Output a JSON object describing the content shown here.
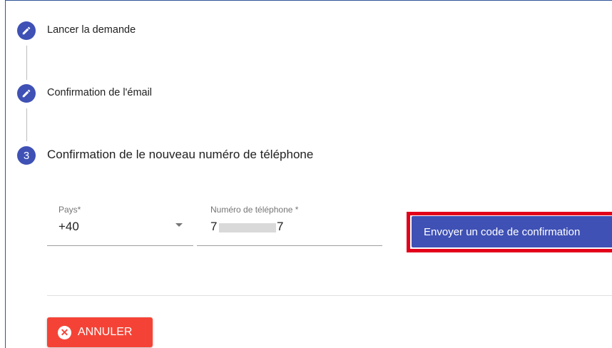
{
  "stepper": {
    "steps": [
      {
        "label": "Lancer la demande",
        "icon": "pencil-icon",
        "state": "completed"
      },
      {
        "label": "Confirmation de l'émail",
        "icon": "pencil-icon",
        "state": "completed"
      },
      {
        "number": "3",
        "label": "Confirmation de le nouveau numéro de téléphone",
        "state": "active"
      }
    ]
  },
  "form": {
    "country": {
      "label": "Pays*",
      "value": "+40"
    },
    "phone": {
      "label": "Numéro de téléphone *",
      "value_start": "7",
      "value_end": "7"
    },
    "send_button": "Envoyer un code de confirmation"
  },
  "actions": {
    "cancel_label": "ANNULER",
    "cancel_icon": "close-circle-icon"
  },
  "colors": {
    "accent": "#3f51b5",
    "danger": "#f44336",
    "highlight": "#e2001a"
  }
}
